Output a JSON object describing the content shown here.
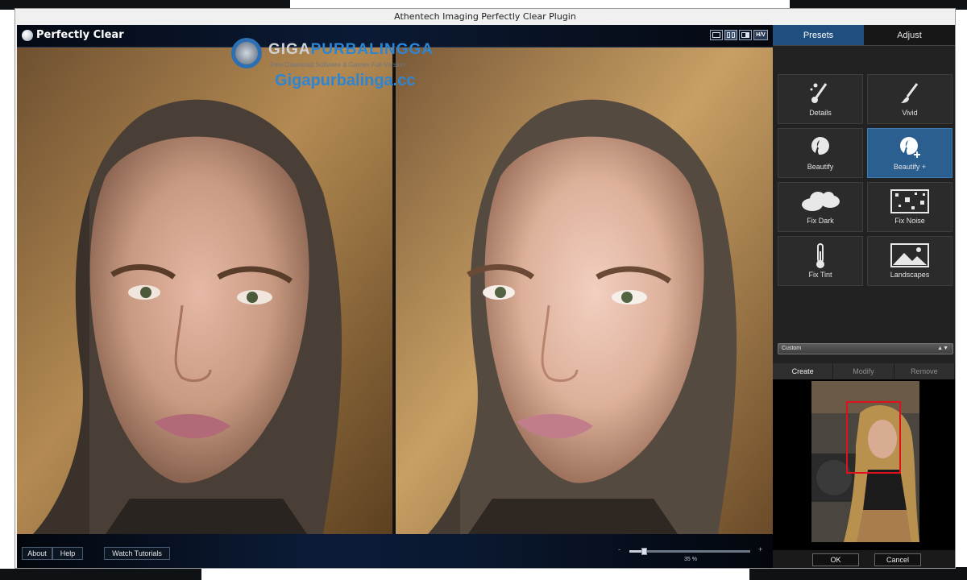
{
  "window": {
    "title": "Athentech Imaging Perfectly Clear Plugin"
  },
  "app": {
    "logo_text": "Perfectly Clear"
  },
  "view_toggle": {
    "hv_label": "H/V"
  },
  "watermark": {
    "title_part1": "GIGA",
    "title_part2": "PURBALINGGA",
    "subtitle": "Free Download Software & Games Full Version",
    "domain": "Gigapurbalinga.cc"
  },
  "bottom_bar": {
    "about": "About",
    "help": "Help",
    "watch_tutorials": "Watch Tutorials",
    "zoom_minus": "-",
    "zoom_plus": "+",
    "zoom_label": "35 %",
    "zoom_value": 0.12
  },
  "panel": {
    "tabs": [
      {
        "label": "Presets",
        "active": true
      },
      {
        "label": "Adjust",
        "active": false
      }
    ],
    "presets": [
      {
        "label": "Details",
        "icon": "brush-sparkle-icon",
        "active": false
      },
      {
        "label": "Vivid",
        "icon": "paintbrush-icon",
        "active": false
      },
      {
        "label": "Beautify",
        "icon": "face-profile-icon",
        "active": false
      },
      {
        "label": "Beautify +",
        "icon": "face-profile-plus-icon",
        "active": true
      },
      {
        "label": "Fix Dark",
        "icon": "clouds-icon",
        "active": false
      },
      {
        "label": "Fix Noise",
        "icon": "noise-icon",
        "active": false
      },
      {
        "label": "Fix Tint",
        "icon": "thermometer-icon",
        "active": false
      },
      {
        "label": "Landscapes",
        "icon": "landscape-icon",
        "active": false
      }
    ],
    "preset_dropdown": {
      "value": "Custom"
    },
    "actions": {
      "create": "Create",
      "modify": "Modify",
      "remove": "Remove"
    },
    "ok": "OK",
    "cancel": "Cancel"
  },
  "colors": {
    "accent": "#1e4f7e",
    "active_preset": "#2a5f90",
    "navigator_box": "#e0111c"
  }
}
